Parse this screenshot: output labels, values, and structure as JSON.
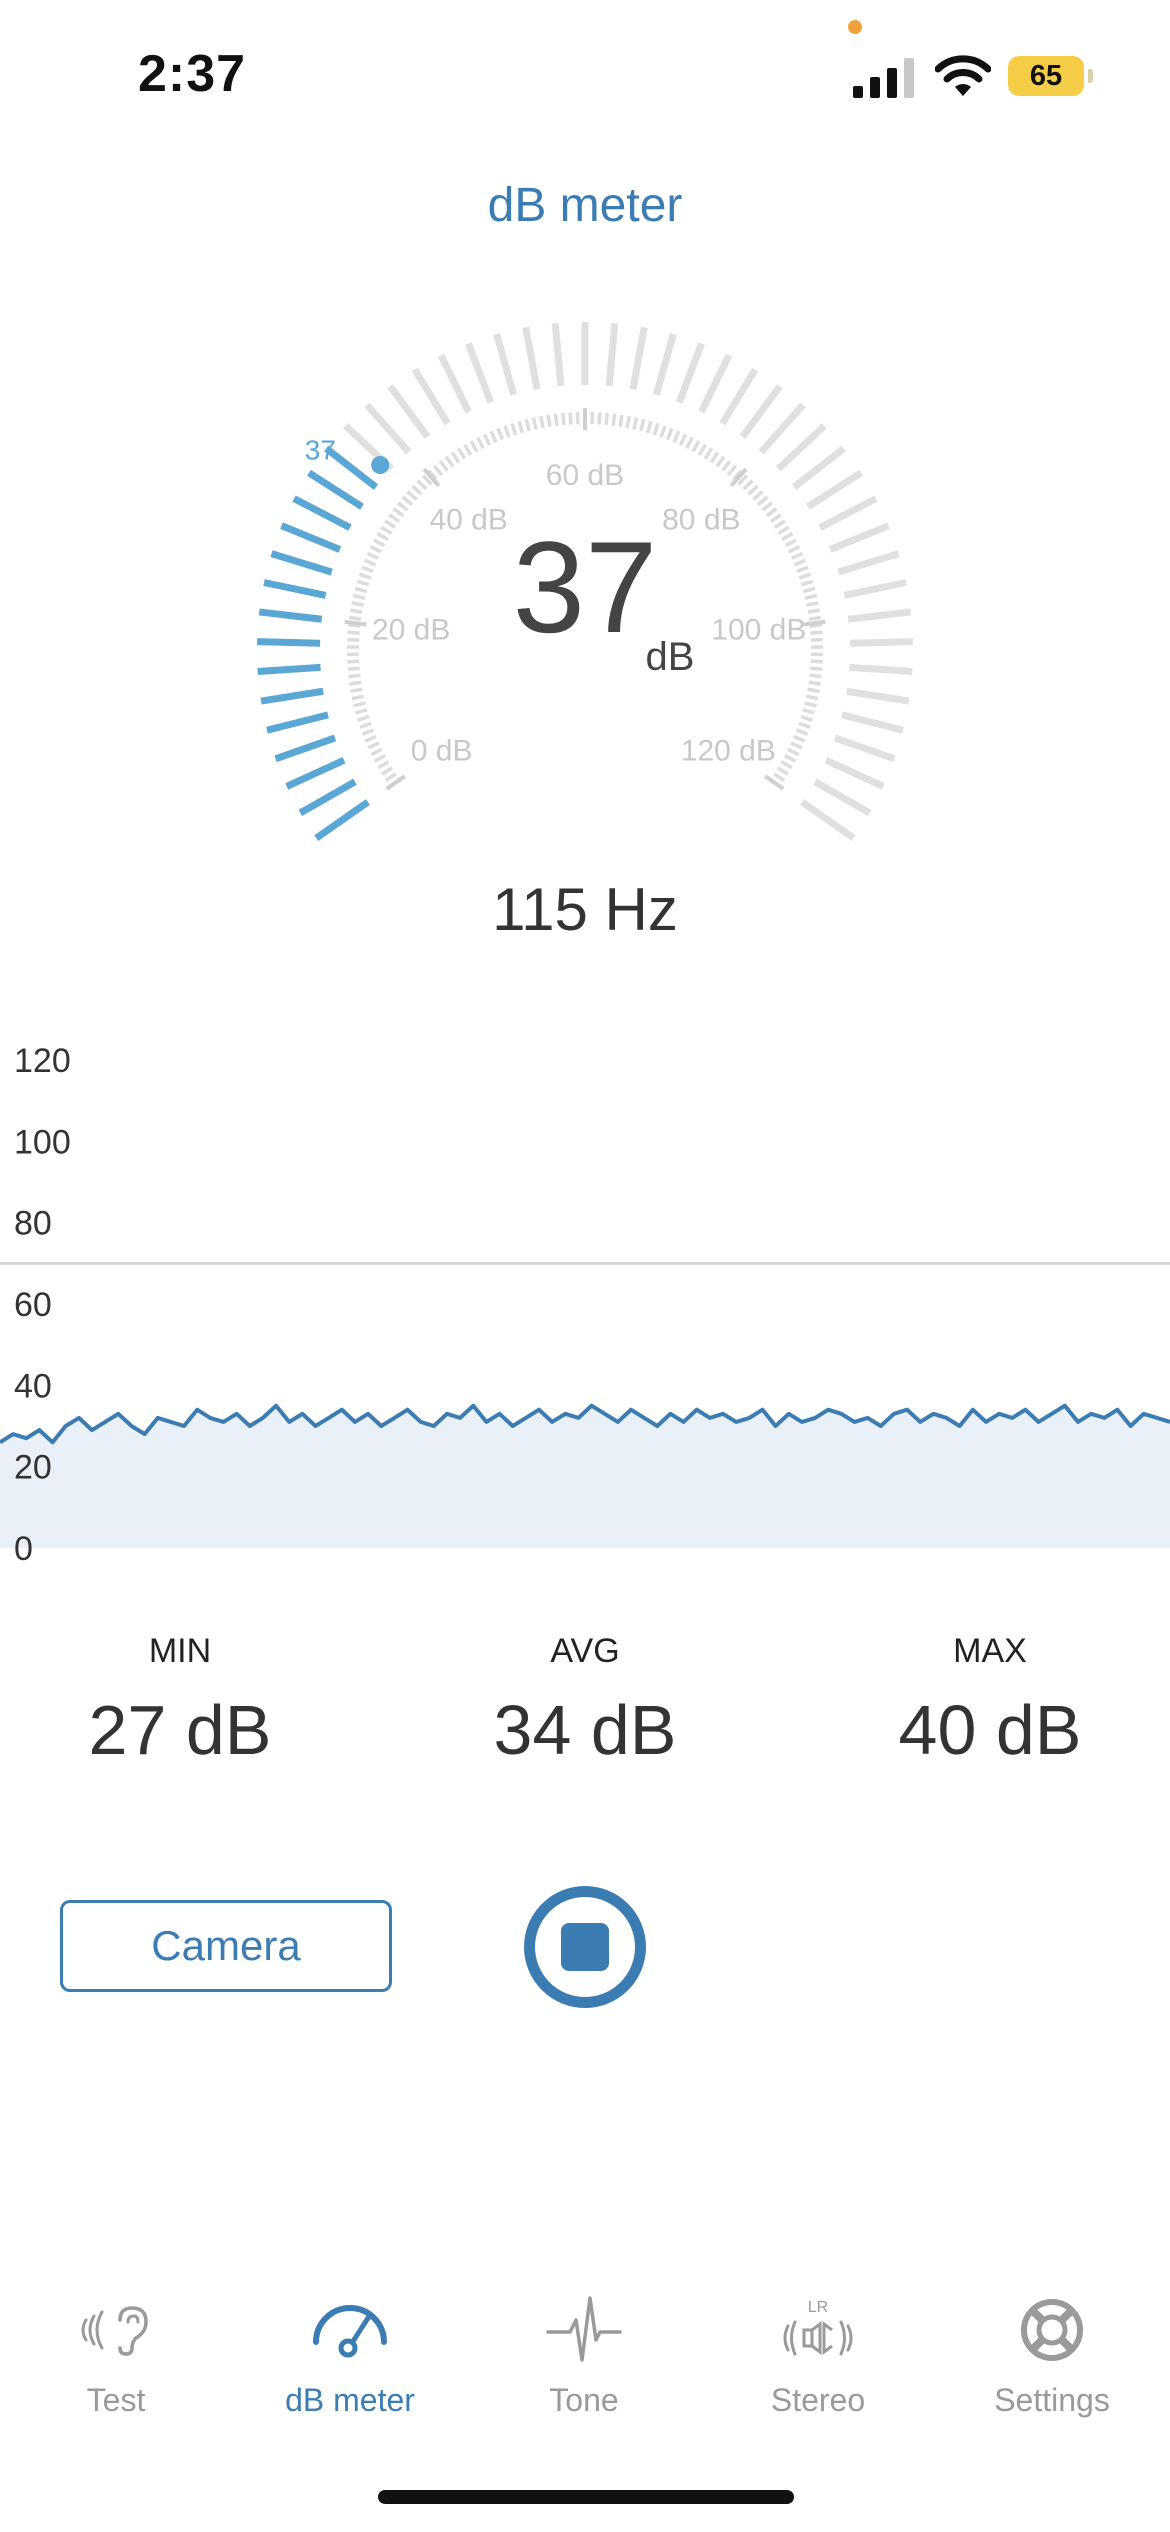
{
  "status_bar": {
    "time": "2:37",
    "battery": "65"
  },
  "header": {
    "title": "dB meter"
  },
  "gauge": {
    "value": "37",
    "unit": "dB",
    "marker_label": "37",
    "level": 37,
    "max": 120,
    "tick_labels": [
      "0 dB",
      "20 dB",
      "40 dB",
      "60 dB",
      "80 dB",
      "100 dB",
      "120 dB"
    ],
    "active_color": "#5aa7d6",
    "inactive_color": "#e0e0e0"
  },
  "frequency": "115 Hz",
  "chart_data": {
    "type": "area",
    "yticks": [
      "120",
      "100",
      "80",
      "60",
      "40",
      "20",
      "0"
    ],
    "ylim": [
      0,
      120
    ],
    "threshold": 70,
    "values": [
      26,
      28,
      27,
      29,
      26,
      30,
      32,
      29,
      31,
      33,
      30,
      28,
      32,
      31,
      30,
      34,
      32,
      31,
      33,
      30,
      32,
      35,
      31,
      33,
      30,
      32,
      34,
      31,
      33,
      30,
      32,
      34,
      31,
      30,
      33,
      32,
      35,
      31,
      33,
      30,
      32,
      34,
      31,
      33,
      32,
      35,
      33,
      31,
      34,
      32,
      30,
      33,
      31,
      34,
      32,
      33,
      31,
      32,
      34,
      30,
      33,
      31,
      32,
      34,
      33,
      31,
      32,
      30,
      33,
      34,
      31,
      33,
      32,
      30,
      34,
      31,
      33,
      32,
      34,
      31,
      33,
      35,
      31,
      33,
      32,
      34,
      30,
      33,
      32,
      31
    ],
    "line_color": "#3b7cb3",
    "fill_color": "#eaf0f8"
  },
  "stats": [
    {
      "label": "MIN",
      "value": "27 dB"
    },
    {
      "label": "AVG",
      "value": "34 dB"
    },
    {
      "label": "MAX",
      "value": "40 dB"
    }
  ],
  "controls": {
    "camera_label": "Camera"
  },
  "tabs": [
    {
      "label": "Test",
      "icon": "hearing-icon"
    },
    {
      "label": "dB meter",
      "icon": "gauge-icon",
      "active": true
    },
    {
      "label": "Tone",
      "icon": "waveform-icon"
    },
    {
      "label": "Stereo",
      "icon": "stereo-speaker-icon"
    },
    {
      "label": "Settings",
      "icon": "lifebuoy-icon"
    }
  ],
  "colors": {
    "accent": "#3b7cb3",
    "muted": "#9a9a9a",
    "battery": "#f5cd47"
  }
}
